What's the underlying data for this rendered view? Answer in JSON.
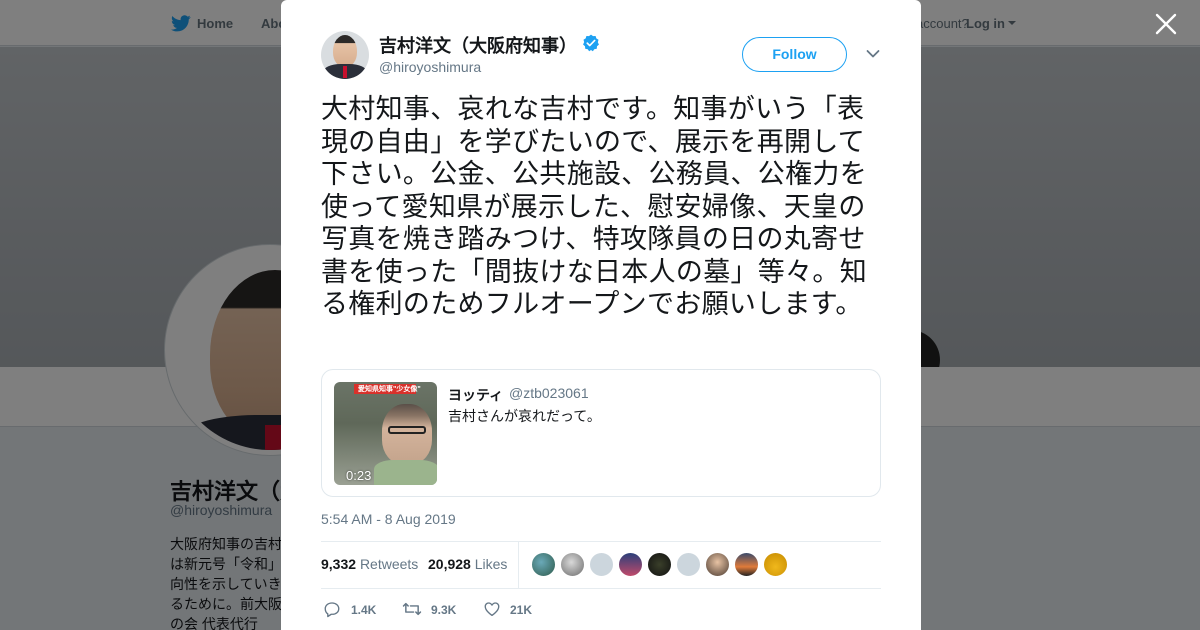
{
  "background": {
    "nav": {
      "home": "Home",
      "about": "Abo",
      "account_prompt": "account?",
      "login": "Log in"
    },
    "profile": {
      "name": "吉村洋文（大",
      "handle": "@hiroyoshimura",
      "bio": "大阪府知事の吉村\nは新元号「令和」\n向性を示していき\nるために。前大阪\nの会 代表代行"
    }
  },
  "tweet": {
    "author": {
      "name": "吉村洋文（大阪府知事）",
      "handle": "@hiroyoshimura",
      "verified": true
    },
    "follow_label": "Follow",
    "text": "大村知事、哀れな吉村です。知事がいう「表現の自由」を学びたいので、展示を再開して下さい。公金、公共施設、公務員、公権力を使って愛知県が展示した、慰安婦像、天皇の写真を焼き踏みつけ、特攻隊員の日の丸寄せ書を使った「間抜けな日本人の墓」等々。知る権利のためフルオープンでお願いします。",
    "quoted": {
      "name": "ヨッティ",
      "handle": "@ztb023061",
      "text": "吉村さんが哀れだって。",
      "duration": "0:23",
      "thumb_caption": "愛知県知事\"少女像\""
    },
    "timestamp": "5:54 AM - 8 Aug 2019",
    "stats": {
      "retweets_count": "9,332",
      "retweets_label": "Retweets",
      "likes_count": "20,928",
      "likes_label": "Likes"
    },
    "actions": {
      "reply": "1.4K",
      "retweet": "9.3K",
      "like": "21K"
    }
  },
  "colors": {
    "brand": "#1da1f2",
    "verified": "#1da1f2",
    "text": "#14171a",
    "muted": "#657786"
  },
  "icons": [
    "twitter-bird-icon",
    "close-icon",
    "verified-badge-icon",
    "chevron-down-icon",
    "reply-icon",
    "retweet-icon",
    "like-icon"
  ]
}
